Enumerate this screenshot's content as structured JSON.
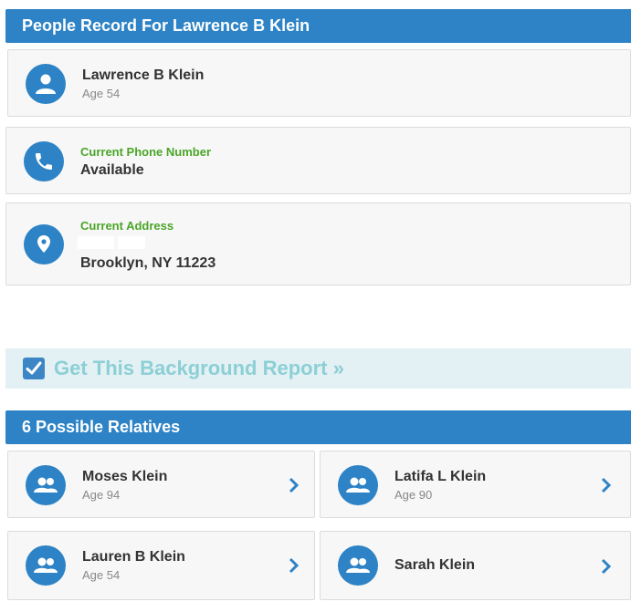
{
  "record_header": {
    "title": "People Record For Lawrence B Klein"
  },
  "person": {
    "name": "Lawrence B Klein",
    "age": "Age 54",
    "icon": "person-icon"
  },
  "phone": {
    "label": "Current Phone Number",
    "value": "Available",
    "icon": "phone-icon"
  },
  "address": {
    "label": "Current Address",
    "city_line": "Brooklyn, NY 11223",
    "icon": "location-pin-icon"
  },
  "cta": {
    "label": "Get This Background Report »",
    "icon": "checkbox-checked-icon"
  },
  "relatives_header": {
    "title": "6 Possible Relatives"
  },
  "relatives": [
    {
      "name": "Moses Klein",
      "age": "Age 94"
    },
    {
      "name": "Latifa L Klein",
      "age": "Age 90"
    },
    {
      "name": "Lauren B Klein",
      "age": "Age 54"
    },
    {
      "name": "Sarah Klein",
      "age": ""
    }
  ],
  "colors": {
    "brand_blue": "#2d83c5",
    "label_green": "#4aa628",
    "cta_text": "#8ccfd5",
    "cta_bg": "#e3f1f4"
  }
}
